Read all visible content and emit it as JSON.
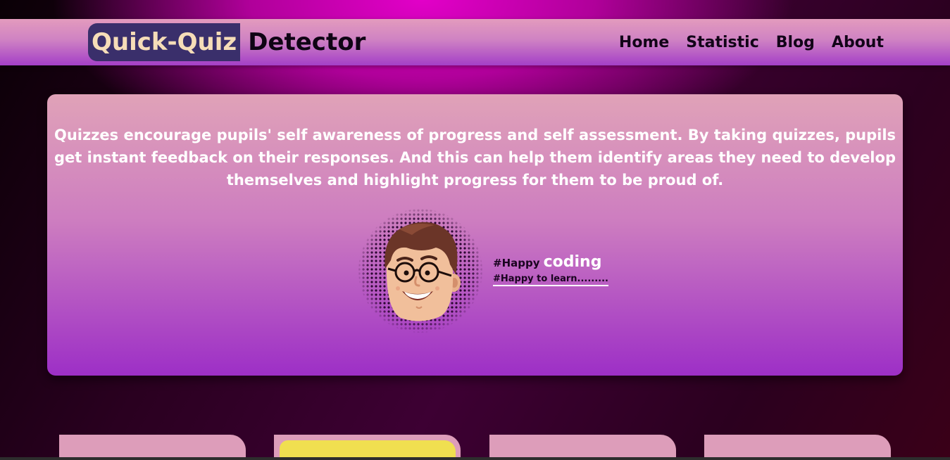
{
  "navbar": {
    "brand_highlight": "Quick-Quiz",
    "brand_rest": "Detector",
    "links": [
      {
        "label": "Home"
      },
      {
        "label": "Statistic"
      },
      {
        "label": "Blog"
      },
      {
        "label": "About"
      }
    ]
  },
  "hero": {
    "description": "Quizzes encourage pupils' self awareness of progress and self assessment. By taking quizzes, pupils get instant feedback on their responses. And this can help them identify areas they need to develop themselves and highlight progress for them to be proud of.",
    "tag_prefix": "#Happy",
    "tag_highlight": "coding",
    "tag_subline": "#Happy to learn.........",
    "avatar_icon": "cartoon-developer-avatar"
  },
  "colors": {
    "brand_highlight_bg": "#3a2f6b",
    "brand_highlight_text": "#f6ddb8",
    "hero_top": "#e0a2b8",
    "hero_bottom": "#9d2fc6",
    "card_pink": "#dd9dba",
    "card_yellow": "#f0df50"
  }
}
